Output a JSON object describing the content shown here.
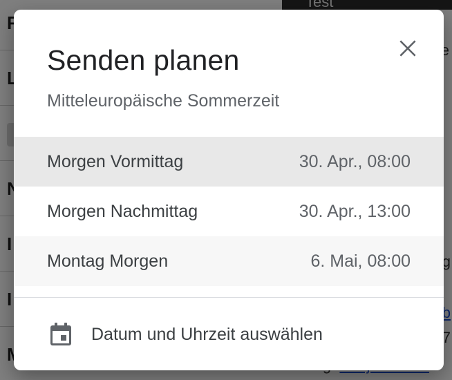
{
  "background": {
    "top_tab_label": "Test",
    "left_letters": [
      "F",
      "L",
      "N",
      "I",
      "I",
      "M"
    ],
    "right_fragments": [
      "e",
      "g"
    ],
    "right_link_fragments": [
      "b",
      "7"
    ],
    "bottom_fragment_prefix": "Ang.",
    "bottom_fragment_link": "Benjamin Bie"
  },
  "dialog": {
    "title": "Senden planen",
    "subtitle": "Mitteleuropäische Sommerzeit",
    "close_icon": "close-icon",
    "options": [
      {
        "label": "Morgen Vormittag",
        "time": "30. Apr., 08:00"
      },
      {
        "label": "Morgen Nachmittag",
        "time": "30. Apr., 13:00"
      },
      {
        "label": "Montag Morgen",
        "time": "6. Mai, 08:00"
      }
    ],
    "pick_icon": "calendar-icon",
    "pick_label": "Datum und Uhrzeit auswählen"
  },
  "colors": {
    "title": "#202124",
    "text": "#3c4043",
    "secondary": "#5f6368",
    "highlight_row": "#e8e8e8",
    "scrim": "#000000"
  }
}
